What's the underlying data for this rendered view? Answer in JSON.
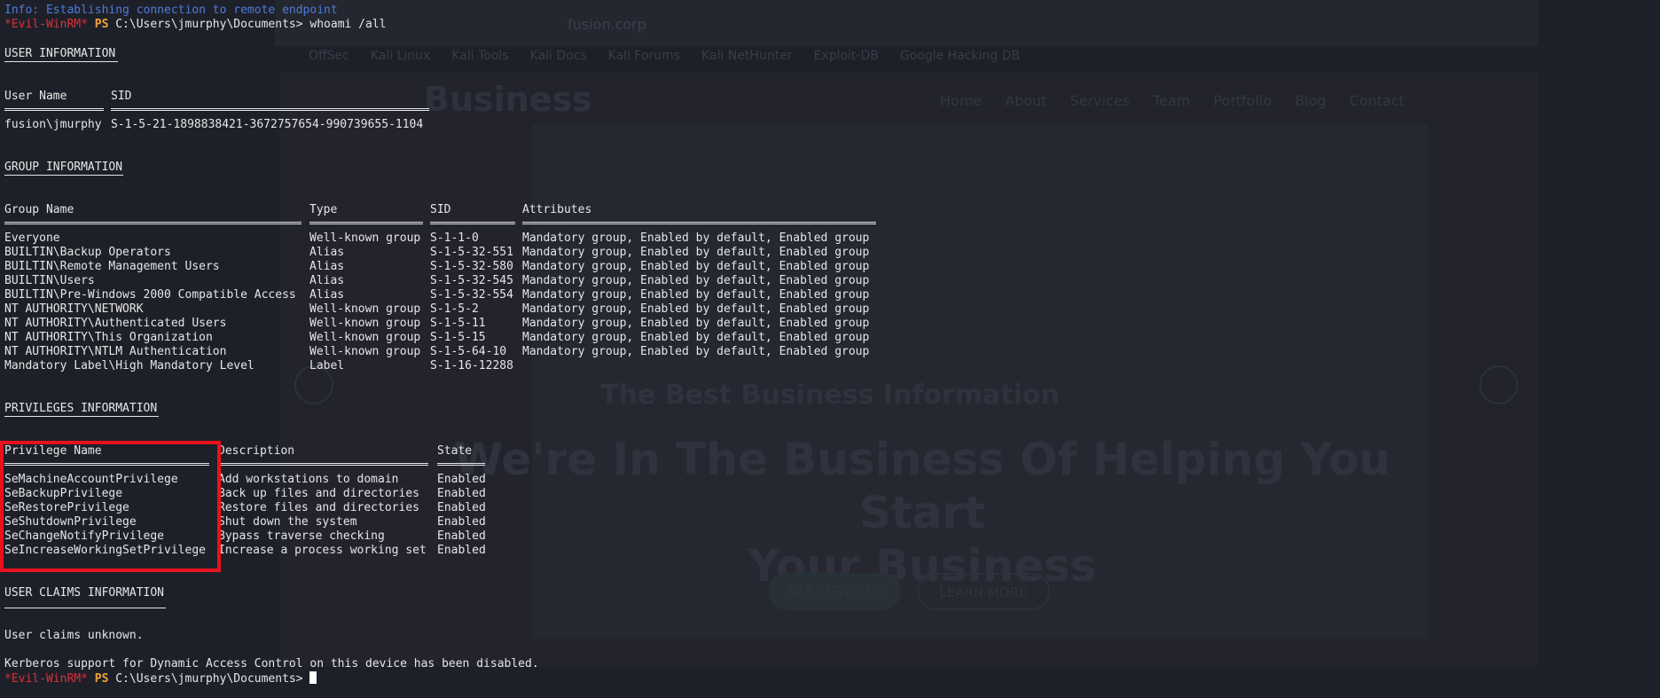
{
  "background": {
    "url_text": "fusion.corp",
    "bookmarks": [
      "OffSec",
      "Kali Linux",
      "Kali Tools",
      "Kali Docs",
      "Kali Forums",
      "Kali NetHunter",
      "Exploit-DB",
      "Google Hacking DB"
    ],
    "site_logo": "Business",
    "nav": [
      "Home",
      "About",
      "Services",
      "Team",
      "Portfolio",
      "Blog",
      "Contact"
    ],
    "hero_small": "The Best Business Information",
    "hero_big_line1": "We're In The Business Of Helping You Start",
    "hero_big_line2": "Your Business",
    "hero_button_1": "SEE SERVICES",
    "hero_button_2": "LEARN MORE"
  },
  "terminal": {
    "info_line": "Info: Establishing connection to remote endpoint",
    "prompt_prefix": "*Evil-WinRM*",
    "prompt_ps": "PS",
    "prompt_path": "C:\\Users\\jmurphy\\Documents>",
    "command": "whoami /all",
    "user_section": {
      "title": "USER INFORMATION",
      "headers": [
        "User Name",
        "SID"
      ],
      "row": [
        "fusion\\jmurphy",
        "S-1-5-21-1898838421-3672757654-990739655-1104"
      ]
    },
    "group_section": {
      "title": "GROUP INFORMATION",
      "headers": [
        "Group Name",
        "Type",
        "SID",
        "Attributes"
      ],
      "rows": [
        [
          "Everyone",
          "Well-known group",
          "S-1-1-0",
          "Mandatory group, Enabled by default, Enabled group"
        ],
        [
          "BUILTIN\\Backup Operators",
          "Alias",
          "S-1-5-32-551",
          "Mandatory group, Enabled by default, Enabled group"
        ],
        [
          "BUILTIN\\Remote Management Users",
          "Alias",
          "S-1-5-32-580",
          "Mandatory group, Enabled by default, Enabled group"
        ],
        [
          "BUILTIN\\Users",
          "Alias",
          "S-1-5-32-545",
          "Mandatory group, Enabled by default, Enabled group"
        ],
        [
          "BUILTIN\\Pre-Windows 2000 Compatible Access",
          "Alias",
          "S-1-5-32-554",
          "Mandatory group, Enabled by default, Enabled group"
        ],
        [
          "NT AUTHORITY\\NETWORK",
          "Well-known group",
          "S-1-5-2",
          "Mandatory group, Enabled by default, Enabled group"
        ],
        [
          "NT AUTHORITY\\Authenticated Users",
          "Well-known group",
          "S-1-5-11",
          "Mandatory group, Enabled by default, Enabled group"
        ],
        [
          "NT AUTHORITY\\This Organization",
          "Well-known group",
          "S-1-5-15",
          "Mandatory group, Enabled by default, Enabled group"
        ],
        [
          "NT AUTHORITY\\NTLM Authentication",
          "Well-known group",
          "S-1-5-64-10",
          "Mandatory group, Enabled by default, Enabled group"
        ],
        [
          "Mandatory Label\\High Mandatory Level",
          "Label",
          "S-1-16-12288",
          ""
        ]
      ]
    },
    "priv_section": {
      "title": "PRIVILEGES INFORMATION",
      "headers": [
        "Privilege Name",
        "Description",
        "State"
      ],
      "rows": [
        [
          "SeMachineAccountPrivilege",
          "Add workstations to domain",
          "Enabled"
        ],
        [
          "SeBackupPrivilege",
          "Back up files and directories",
          "Enabled"
        ],
        [
          "SeRestorePrivilege",
          "Restore files and directories",
          "Enabled"
        ],
        [
          "SeShutdownPrivilege",
          "Shut down the system",
          "Enabled"
        ],
        [
          "SeChangeNotifyPrivilege",
          "Bypass traverse checking",
          "Enabled"
        ],
        [
          "SeIncreaseWorkingSetPrivilege",
          "Increase a process working set",
          "Enabled"
        ]
      ]
    },
    "claims_section": {
      "title": "USER CLAIMS INFORMATION",
      "line1": "User claims unknown.",
      "line2": "Kerberos support for Dynamic Access Control on this device has been disabled."
    }
  },
  "colors": {
    "background": "#1e2029",
    "text": "#e6e6e6",
    "info": "#4d7bd8",
    "evil_prompt": "#d9303a",
    "ps_prompt": "#f0a13a",
    "highlight": "#e8121d"
  }
}
